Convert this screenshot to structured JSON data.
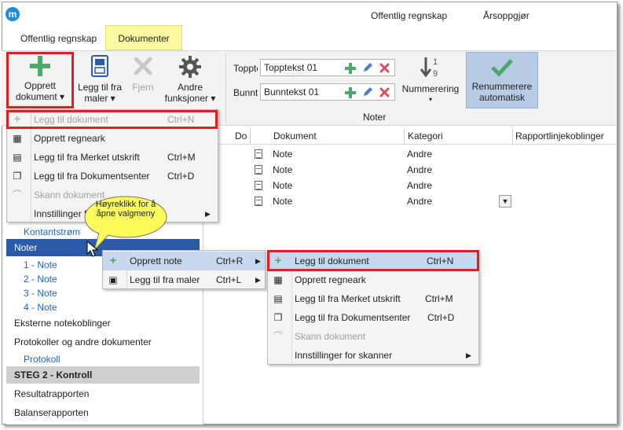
{
  "app": {
    "logo_letter": "m",
    "brand_color": "#1c8de0"
  },
  "top_menu": [
    "Offentlig regnskap",
    "Årsoppgjør"
  ],
  "ribbon_tabs": [
    {
      "label": "Offentlig regnskap"
    },
    {
      "label": "Dokumenter"
    }
  ],
  "ribbon": {
    "opprett_dokument": [
      "Opprett",
      "dokument ▾"
    ],
    "legg_til_fra_maler": [
      "Legg til fra",
      "maler ▾"
    ],
    "fjern": "Fjern",
    "andre_funksjoner": [
      "Andre",
      "funksjoner ▾"
    ],
    "topptekst_label": "Topptekst",
    "topptekst_value": "Topptekst 01",
    "bunntekst_label": "Bunntekst",
    "bunntekst_value": "Bunntekst 01",
    "nummerering": "Nummerering",
    "renummerere": [
      "Renummerere",
      "automatisk"
    ],
    "group_noter": "Noter"
  },
  "menu1": {
    "items": [
      {
        "icon": "plus-icon",
        "label": "Legg til dokument",
        "shortcut": "Ctrl+N",
        "disabled": true
      },
      {
        "icon": "spreadsheet-icon",
        "label": "Opprett regneark",
        "shortcut": ""
      },
      {
        "icon": "print-add-icon",
        "label": "Legg til fra Merket utskrift",
        "shortcut": "Ctrl+M"
      },
      {
        "icon": "documents-icon",
        "label": "Legg til fra Dokumentsenter",
        "shortcut": "Ctrl+D"
      },
      {
        "icon": "scanner-icon",
        "label": "Skann dokument",
        "shortcut": "",
        "disabled": true
      },
      {
        "icon": "",
        "label": "Innstillinger for skanner",
        "shortcut": ""
      }
    ]
  },
  "callout": "Høyreklikk for å åpne valgmeny",
  "context_menu": {
    "items": [
      {
        "label": "Opprett note",
        "shortcut": "Ctrl+R"
      },
      {
        "label": "Legg til fra maler",
        "shortcut": "Ctrl+L"
      }
    ]
  },
  "submenu": {
    "items": [
      {
        "label": "Legg til dokument",
        "shortcut": "Ctrl+N"
      },
      {
        "label": "Opprett regneark",
        "shortcut": ""
      },
      {
        "label": "Legg til fra Merket utskrift",
        "shortcut": "Ctrl+M"
      },
      {
        "label": "Legg til fra Dokumentsenter",
        "shortcut": "Ctrl+D"
      },
      {
        "label": "Skann dokument",
        "shortcut": ""
      },
      {
        "label": "Innstillinger for skanner",
        "shortcut": ""
      }
    ]
  },
  "nav": {
    "kontantstrom": "Kontantstrøm",
    "noter": "Noter",
    "notes": [
      "1 - Note",
      "2 - Note",
      "3 - Note",
      "4 - Note"
    ],
    "eksterne": "Eksterne notekoblinger",
    "protokoller": "Protokoller og andre dokumenter",
    "protokoll": "Protokoll",
    "steg2": "STEG 2 - Kontroll",
    "resultat": "Resultatrapporten",
    "balanse": "Balanserapporten"
  },
  "grid": {
    "headers": [
      "Do",
      "Dokument",
      "Kategori",
      "Rapportlinjekoblinger"
    ],
    "rows": [
      {
        "dokument": "Note",
        "kategori": "Andre"
      },
      {
        "dokument": "Note",
        "kategori": "Andre"
      },
      {
        "dokument": "Note",
        "kategori": "Andre"
      },
      {
        "dokument": "Note",
        "kategori": "Andre"
      }
    ]
  },
  "colors": {
    "accent": "#2b5aa6",
    "highlight": "#e02020",
    "green": "#4aa86a",
    "red": "#d9505c"
  }
}
